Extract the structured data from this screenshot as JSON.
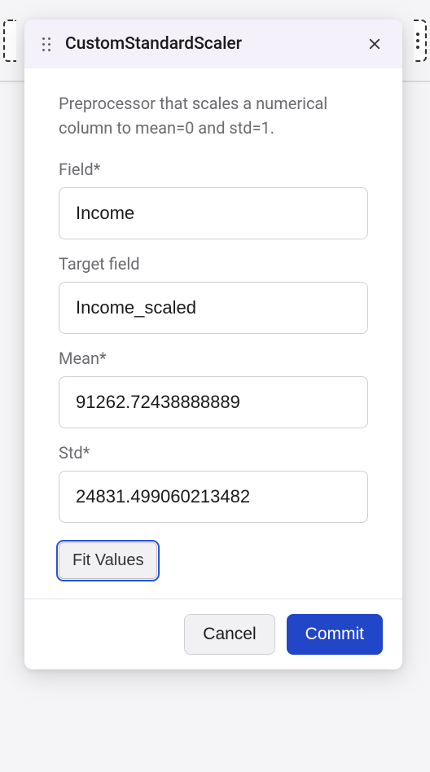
{
  "header": {
    "title": "CustomStandardScaler"
  },
  "body": {
    "description": "Preprocessor that scales a numerical column to mean=0 and std=1.",
    "fields": {
      "field": {
        "label": "Field*",
        "value": "Income"
      },
      "target_field": {
        "label": "Target field",
        "value": "Income_scaled"
      },
      "mean": {
        "label": "Mean*",
        "value": "91262.72438888889"
      },
      "std": {
        "label": "Std*",
        "value": "24831.499060213482"
      }
    },
    "fit_button": "Fit Values"
  },
  "footer": {
    "cancel": "Cancel",
    "commit": "Commit"
  }
}
